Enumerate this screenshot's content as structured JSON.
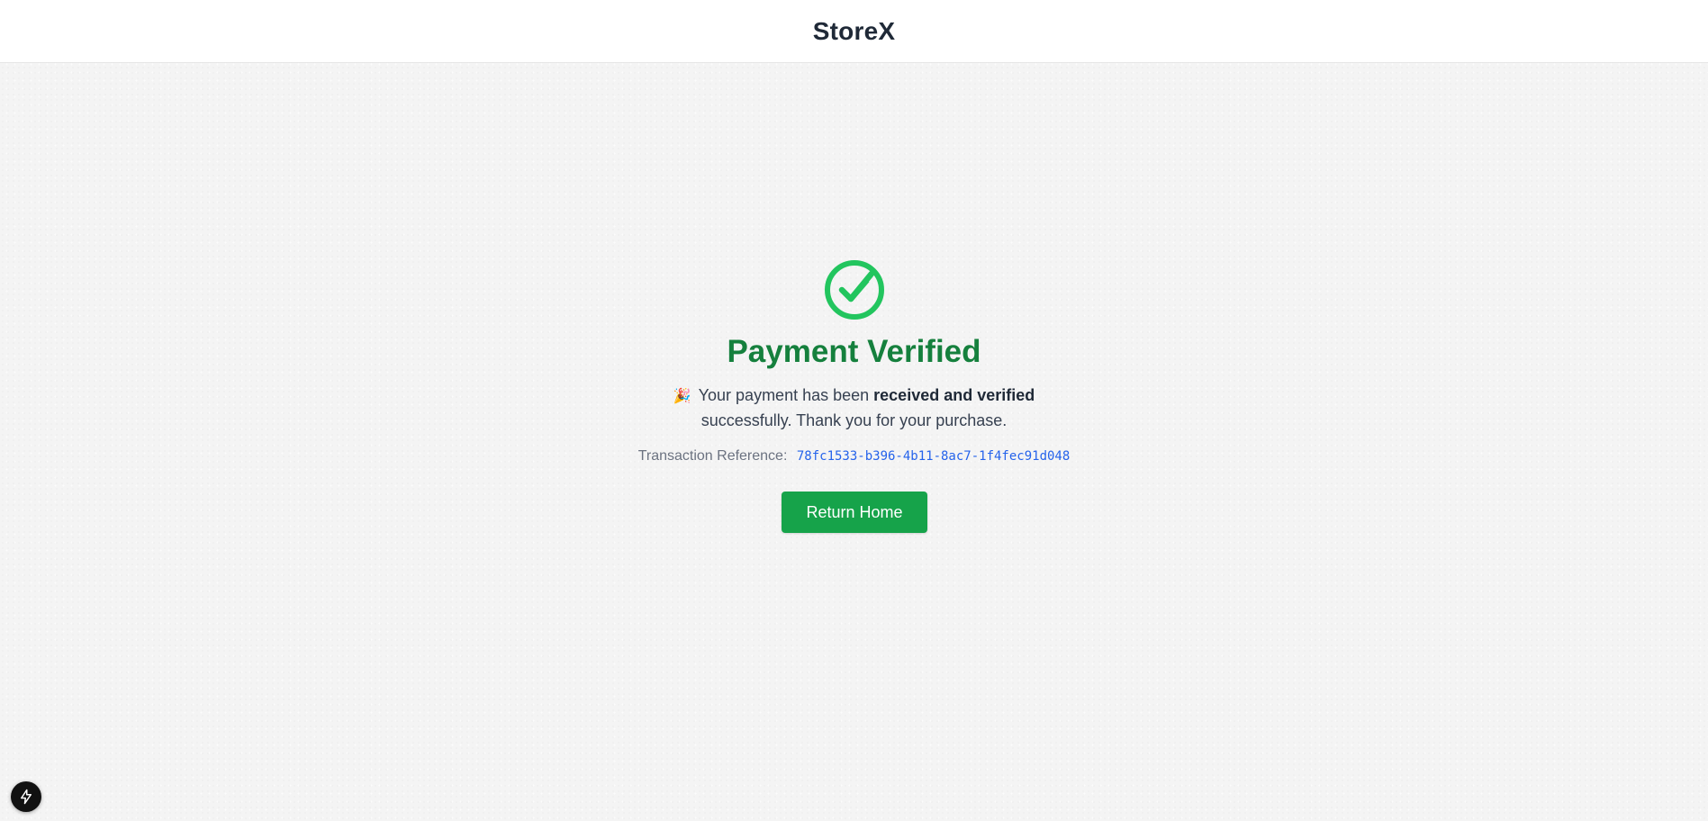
{
  "header": {
    "brand": "StoreX"
  },
  "status": {
    "icon": "check-circle-icon",
    "title": "Payment Verified",
    "message_emoji": "🎉",
    "message_prefix": "Your payment has been ",
    "message_bold": "received and verified",
    "message_suffix": " successfully. Thank you for your purchase.",
    "transaction_label": "Transaction Reference:",
    "transaction_ref": "78fc1533-b396-4b11-8ac7-1f4fec91d048"
  },
  "actions": {
    "return_home_label": "Return Home"
  },
  "dev_badge": {
    "icon": "lightning-bolt-icon"
  },
  "colors": {
    "success": "#22c55e",
    "title": "#15803d",
    "button": "#16a34a",
    "link": "#2563eb"
  }
}
